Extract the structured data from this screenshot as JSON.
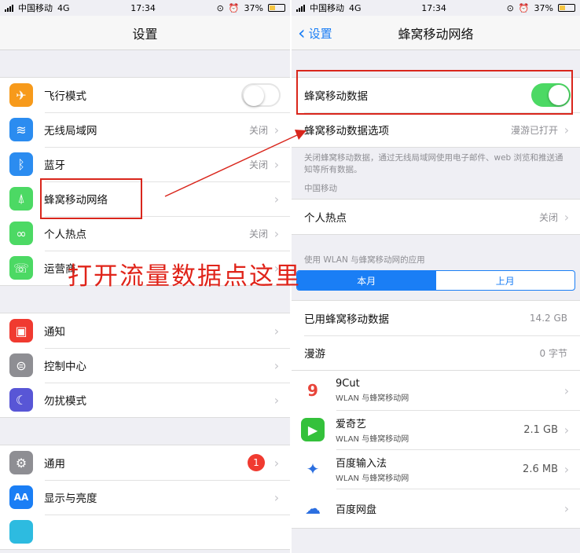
{
  "left": {
    "status": {
      "carrier": "中国移动",
      "network": "4G",
      "time": "17:34",
      "battery": "37%"
    },
    "nav_title": "设置",
    "group1": [
      {
        "label": "飞行模式",
        "icon": "airplane-icon",
        "color": "#f79a1b",
        "glyph": "✈",
        "toggle": "off"
      },
      {
        "label": "无线局域网",
        "icon": "wifi-icon",
        "color": "#2b8cf0",
        "glyph": "≋",
        "value": "关闭"
      },
      {
        "label": "蓝牙",
        "icon": "bluetooth-icon",
        "color": "#2b8cf0",
        "glyph": "ᛒ",
        "value": "关闭"
      },
      {
        "label": "蜂窝移动网络",
        "icon": "cellular-icon",
        "color": "#4cd964",
        "glyph": "⍋",
        "value": ""
      },
      {
        "label": "个人热点",
        "icon": "hotspot-icon",
        "color": "#4cd964",
        "glyph": "∞",
        "value": "关闭"
      },
      {
        "label": "运营商",
        "icon": "phone-icon",
        "color": "#4cd964",
        "glyph": "☏",
        "value": ""
      }
    ],
    "group2": [
      {
        "label": "通知",
        "icon": "notifications-icon",
        "color": "#f03a30",
        "glyph": "▣"
      },
      {
        "label": "控制中心",
        "icon": "control-center-icon",
        "color": "#8e8e93",
        "glyph": "⊜"
      },
      {
        "label": "勿扰模式",
        "icon": "moon-icon",
        "color": "#5856d6",
        "glyph": "☾"
      }
    ],
    "group3": [
      {
        "label": "通用",
        "icon": "gear-icon",
        "color": "#8e8e93",
        "glyph": "⚙",
        "badge": "1"
      },
      {
        "label": "显示与亮度",
        "icon": "display-icon",
        "color": "#1a7ef5",
        "glyph": "AA"
      },
      {
        "label": "",
        "icon": "wallpaper-icon",
        "color": "#2dbbe0",
        "glyph": ""
      }
    ]
  },
  "right": {
    "status": {
      "carrier": "中国移动",
      "network": "4G",
      "time": "17:34",
      "battery": "37%"
    },
    "back_label": "设置",
    "nav_title": "蜂窝移动网络",
    "cellular_data_label": "蜂窝移动数据",
    "cellular_data_on": true,
    "options_label": "蜂窝移动数据选项",
    "options_value": "漫游已打开",
    "footer": "关闭蜂窝移动数据，通过无线局域网使用电子邮件、web 浏览和推送通知等所有数据。",
    "section_carrier": "中国移动",
    "hotspot_label": "个人热点",
    "hotspot_value": "关闭",
    "usage_header": "使用 WLAN 与蜂窝移动网的应用",
    "seg_current": "本月",
    "seg_last": "上月",
    "used_label": "已用蜂窝移动数据",
    "used_value": "14.2 GB",
    "roaming_label": "漫游",
    "roaming_value": "0 字节",
    "apps": [
      {
        "name": "9Cut",
        "sub": "WLAN 与蜂窝移动网",
        "size": "",
        "icon": "ninecut-app-icon",
        "color": "#ffffff",
        "glyph": "9"
      },
      {
        "name": "爱奇艺",
        "sub": "WLAN 与蜂窝移动网",
        "size": "2.1 GB",
        "icon": "iqiyi-app-icon",
        "color": "#34c13b",
        "glyph": "▶"
      },
      {
        "name": "百度输入法",
        "sub": "WLAN 与蜂窝移动网",
        "size": "2.6 MB",
        "icon": "baidu-input-app-icon",
        "color": "#ffffff",
        "glyph": "✦"
      },
      {
        "name": "百度网盘",
        "sub": "",
        "size": "",
        "icon": "baidu-pan-app-icon",
        "color": "#ffffff",
        "glyph": "☁"
      }
    ]
  },
  "annotation": "打开流量数据点这里",
  "accent_colors": {
    "ios_blue": "#1a7ef5",
    "toggle_green": "#4cd964",
    "annotation_red": "#d9261c"
  }
}
